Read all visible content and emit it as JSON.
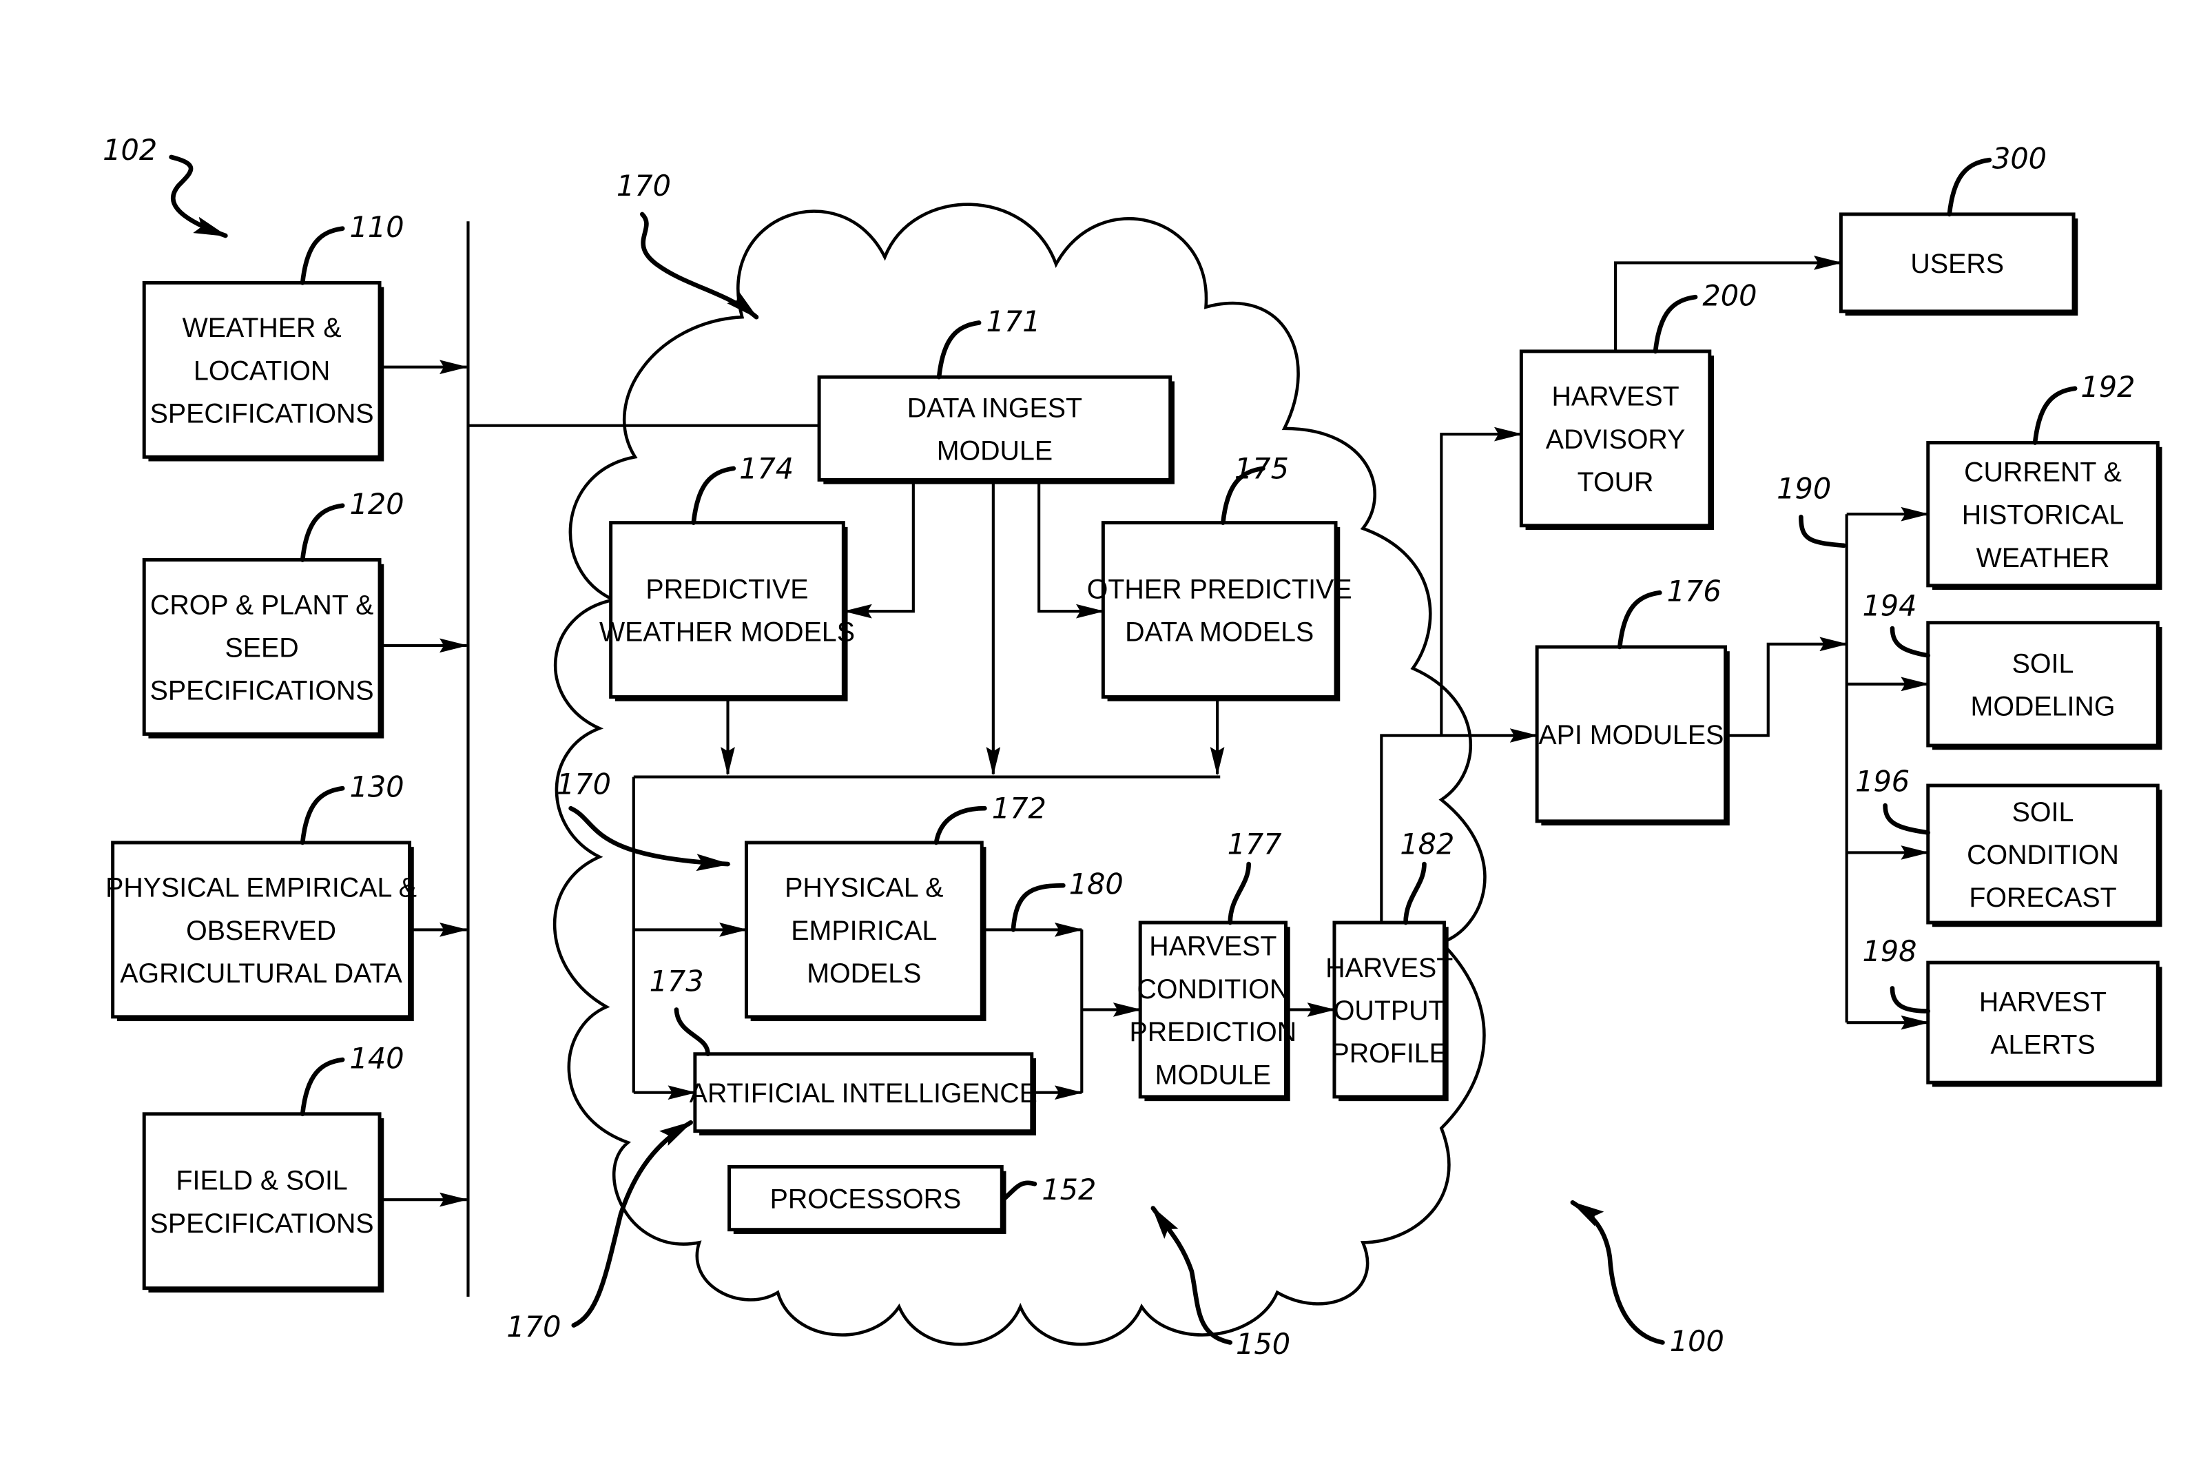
{
  "figure": {
    "system_ref": "100",
    "colors": {
      "stroke": "#000000",
      "background": "#ffffff"
    }
  },
  "inputs": {
    "group_ref": "102",
    "items": [
      {
        "ref": "110",
        "lines": [
          "WEATHER &",
          "LOCATION",
          "SPECIFICATIONS"
        ]
      },
      {
        "ref": "120",
        "lines": [
          "CROP &  PLANT &",
          "SEED",
          "SPECIFICATIONS"
        ]
      },
      {
        "ref": "130",
        "lines": [
          "PHYSICAL EMPIRICAL &",
          "OBSERVED",
          "AGRICULTURAL DATA"
        ]
      },
      {
        "ref": "140",
        "lines": [
          "FIELD & SOIL",
          "SPECIFICATIONS"
        ]
      }
    ]
  },
  "cloud": {
    "ref": "150",
    "platform_ref": "170",
    "data_ingest": {
      "ref": "171",
      "lines": [
        "DATA INGEST",
        "MODULE"
      ]
    },
    "predictive_weather": {
      "ref": "174",
      "lines": [
        "PREDICTIVE",
        "WEATHER MODELS"
      ]
    },
    "other_predictive": {
      "ref": "175",
      "lines": [
        "OTHER PREDICTIVE",
        "DATA MODELS"
      ]
    },
    "physical_empirical": {
      "ref": "172",
      "lines": [
        "PHYSICAL &",
        "EMPIRICAL",
        "MODELS"
      ]
    },
    "ai": {
      "ref": "173",
      "lines": [
        "ARTIFICIAL INTELLIGENCE"
      ]
    },
    "model_output_ref": "180",
    "harvest_condition": {
      "ref": "177",
      "lines": [
        "HARVEST",
        "CONDITION",
        "PREDICTION",
        "MODULE"
      ]
    },
    "harvest_output": {
      "ref": "182",
      "lines": [
        "HARVEST",
        "OUTPUT",
        "PROFILE"
      ]
    },
    "processors": {
      "ref": "152",
      "lines": [
        "PROCESSORS"
      ]
    }
  },
  "outputs": {
    "api_modules": {
      "ref": "176",
      "lines": [
        "API MODULES"
      ]
    },
    "harvest_advisory": {
      "ref": "200",
      "lines": [
        "HARVEST",
        "ADVISORY",
        "TOUR"
      ]
    },
    "users": {
      "ref": "300",
      "lines": [
        "USERS"
      ]
    },
    "api_group_ref": "190",
    "api_items": [
      {
        "ref": "192",
        "lines": [
          "CURRENT &",
          "HISTORICAL",
          "WEATHER"
        ]
      },
      {
        "ref": "194",
        "lines": [
          "SOIL",
          "MODELING"
        ]
      },
      {
        "ref": "196",
        "lines": [
          "SOIL",
          "CONDITION",
          "FORECAST"
        ]
      },
      {
        "ref": "198",
        "lines": [
          "HARVEST",
          "ALERTS"
        ]
      }
    ]
  }
}
